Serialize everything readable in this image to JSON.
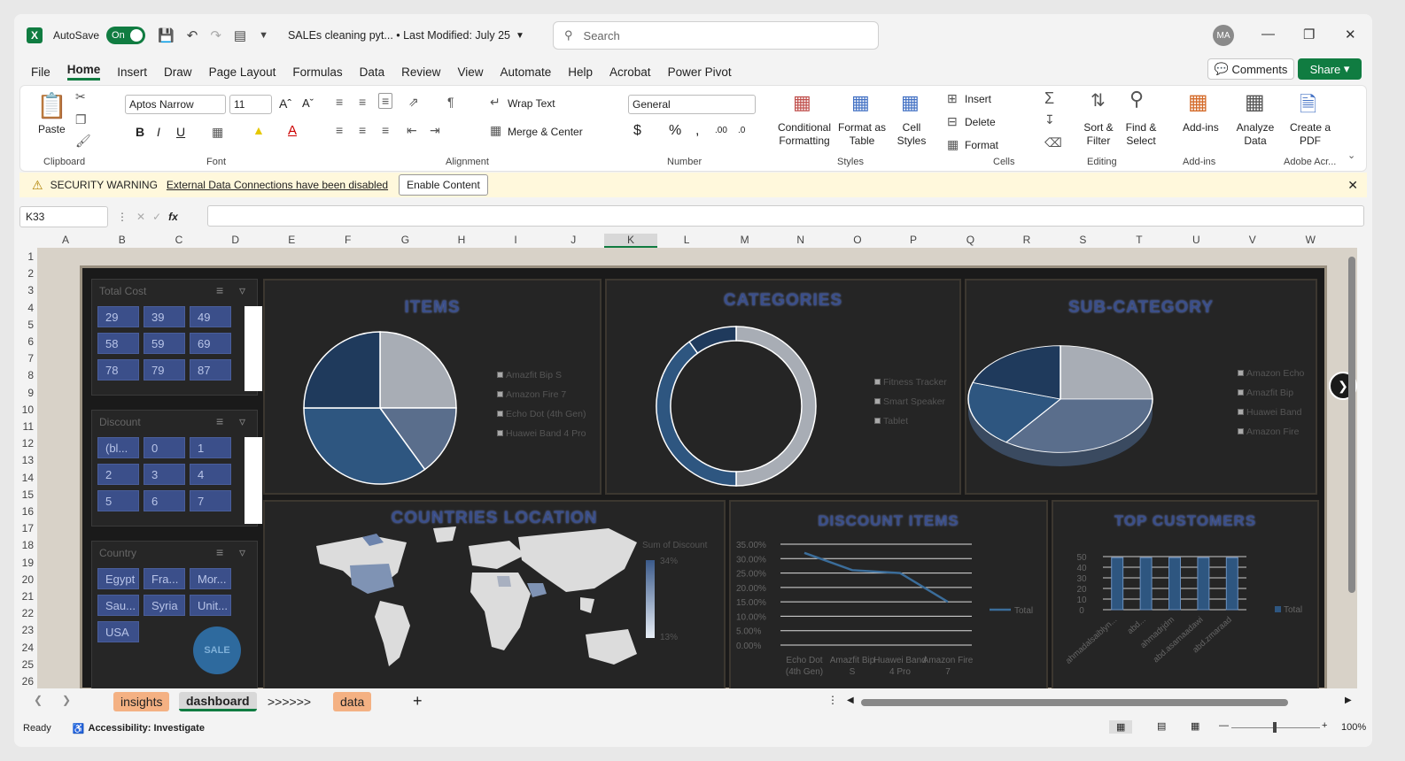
{
  "titlebar": {
    "autosave_label": "AutoSave",
    "autosave_state": "On",
    "document_title": "SALEs cleaning pyt... • Last Modified: July 25",
    "search_placeholder": "Search",
    "avatar_initials": "MA"
  },
  "menu": [
    "File",
    "Home",
    "Insert",
    "Draw",
    "Page Layout",
    "Formulas",
    "Data",
    "Review",
    "View",
    "Automate",
    "Help",
    "Acrobat",
    "Power Pivot"
  ],
  "menu_active": "Home",
  "comments_label": "Comments",
  "share_label": "Share",
  "ribbon": {
    "paste": "Paste",
    "font_name": "Aptos Narrow",
    "font_size": "11",
    "wrap_text": "Wrap Text",
    "merge_center": "Merge & Center",
    "number_format": "General",
    "conditional_formatting": "Conditional Formatting",
    "format_as_table": "Format as Table",
    "cell_styles": "Cell Styles",
    "insert": "Insert",
    "delete": "Delete",
    "format": "Format",
    "sort_filter": "Sort & Filter",
    "find_select": "Find & Select",
    "add_ins": "Add-ins",
    "analyze_data": "Analyze Data",
    "create_pdf": "Create a PDF",
    "groups": [
      "Clipboard",
      "Font",
      "Alignment",
      "Number",
      "Styles",
      "Cells",
      "Editing",
      "Add-ins",
      "Adobe Acr..."
    ]
  },
  "warning": {
    "title": "SECURITY WARNING",
    "message": "External Data Connections have been disabled",
    "button": "Enable Content"
  },
  "name_box": "K33",
  "fx_label": "fx",
  "columns": [
    "A",
    "B",
    "C",
    "D",
    "E",
    "F",
    "G",
    "H",
    "I",
    "J",
    "K",
    "L",
    "M",
    "N",
    "O",
    "P",
    "Q",
    "R",
    "S",
    "T",
    "U",
    "V",
    "W"
  ],
  "rows": [
    "1",
    "2",
    "3",
    "4",
    "5",
    "6",
    "7",
    "8",
    "9",
    "10",
    "11",
    "12",
    "13",
    "14",
    "15",
    "16",
    "17",
    "18",
    "19",
    "20",
    "21",
    "22",
    "23",
    "24",
    "25",
    "26"
  ],
  "slicers": [
    {
      "title": "Total Cost",
      "items": [
        "29",
        "39",
        "49",
        "58",
        "59",
        "69",
        "78",
        "79",
        "87"
      ]
    },
    {
      "title": "Discount",
      "items": [
        "(bl...",
        "0",
        "1",
        "2",
        "3",
        "4",
        "5",
        "6",
        "7"
      ]
    },
    {
      "title": "Country",
      "items": [
        "Egypt",
        "Fra...",
        "Mor...",
        "Sau...",
        "Syria",
        "Unit...",
        "USA"
      ]
    }
  ],
  "logo_text": "SALE",
  "panels": {
    "items": {
      "title": "ITEMS",
      "legend": [
        "Amazfit Bip S",
        "Amazon Fire 7",
        "Echo Dot (4th Gen)",
        "Huawei Band 4 Pro"
      ]
    },
    "categories": {
      "title": "CATEGORIES",
      "legend": [
        "Fitness Tracker",
        "Smart Speaker",
        "Tablet"
      ]
    },
    "subcategory": {
      "title": "SUB-CATEGORY",
      "legend": [
        "Amazon Echo",
        "Amazfit Bip",
        "Huawei Band",
        "Amazon Fire"
      ]
    },
    "countries": {
      "title": "COUNTRIES LOCATION",
      "legend_title": "Sum of Discount",
      "max_label": "34%",
      "min_label": "13%"
    },
    "discount": {
      "title": "DISCOUNT ITEMS",
      "series": "Total"
    },
    "customers": {
      "title": "TOP CUSTOMERS",
      "series": "Total"
    }
  },
  "chart_data": [
    {
      "type": "pie",
      "title": "ITEMS",
      "categories": [
        "Amazfit Bip S",
        "Amazon Fire 7",
        "Echo Dot (4th Gen)",
        "Huawei Band 4 Pro"
      ],
      "values": [
        25,
        15,
        35,
        25
      ]
    },
    {
      "type": "pie",
      "title": "CATEGORIES",
      "categories": [
        "Fitness Tracker",
        "Smart Speaker",
        "Tablet"
      ],
      "values": [
        50,
        40,
        10
      ]
    },
    {
      "type": "pie",
      "title": "SUB-CATEGORY",
      "categories": [
        "Amazon Echo",
        "Amazfit Bip",
        "Huawei Band",
        "Amazon Fire"
      ],
      "values": [
        25,
        35,
        20,
        20
      ]
    },
    {
      "type": "line",
      "title": "DISCOUNT ITEMS",
      "categories": [
        "Echo Dot (4th Gen)",
        "Amazfit Bip S",
        "Huawei Band 4 Pro",
        "Amazon Fire 7"
      ],
      "series": [
        {
          "name": "Total",
          "values": [
            0.32,
            0.26,
            0.25,
            0.15
          ]
        }
      ],
      "yticks": [
        "35.00%",
        "30.00%",
        "25.00%",
        "20.00%",
        "15.00%",
        "10.00%",
        "5.00%",
        "0.00%"
      ],
      "ylim": [
        0,
        0.35
      ]
    },
    {
      "type": "bar",
      "title": "TOP CUSTOMERS",
      "categories": [
        "ahmadalsaiblyn...",
        "abd...",
        "ahmadrjdm",
        "abd.asamaadawi",
        "abd.zmaraad"
      ],
      "series": [
        {
          "name": "Total",
          "values": [
            49,
            49,
            49,
            49,
            49
          ]
        }
      ],
      "yticks": [
        "50",
        "40",
        "30",
        "20",
        "10",
        "0"
      ],
      "ylim": [
        0,
        50
      ]
    }
  ],
  "sheet_tabs": [
    "insights",
    "dashboard",
    ">>>>>>",
    "data"
  ],
  "status": {
    "ready": "Ready",
    "accessibility": "Accessibility: Investigate",
    "zoom": "100%"
  },
  "colors": {
    "excel_green": "#107c41",
    "dark_blue": "#1f3a5c",
    "mid_blue": "#2e5680",
    "slate": "#5a6e8c",
    "gray": "#a8adb5",
    "tab_orange": "#f4b183",
    "slicer_blue": "#3b4f8a"
  }
}
